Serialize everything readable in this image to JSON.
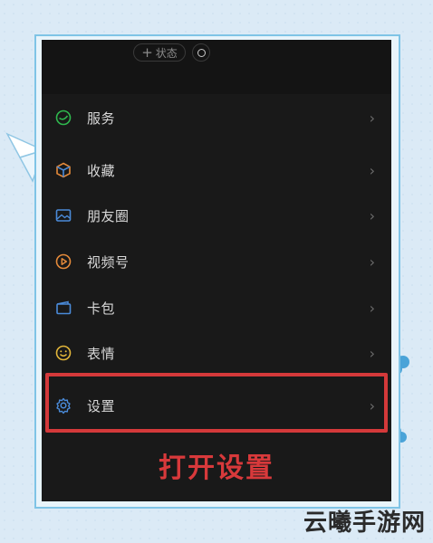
{
  "status_bar": {
    "plus_glyph": "+",
    "status_label": "状态"
  },
  "menu": {
    "items": [
      {
        "label": "服务",
        "icon": "service-icon",
        "color": "#2fb84e"
      },
      {
        "label": "收藏",
        "icon": "cube-icon",
        "color": "#e58a3a"
      },
      {
        "label": "朋友圈",
        "icon": "image-icon",
        "color": "#4a8ad8"
      },
      {
        "label": "视频号",
        "icon": "play-icon",
        "color": "#e58a3a"
      },
      {
        "label": "卡包",
        "icon": "wallet-icon",
        "color": "#4a8ad8"
      },
      {
        "label": "表情",
        "icon": "smile-icon",
        "color": "#e2b63a"
      },
      {
        "label": "设置",
        "icon": "gear-icon",
        "color": "#4a8ad8"
      }
    ],
    "chevron": "›"
  },
  "caption": "打开设置",
  "highlight_color": "#d4393a",
  "watermark": "云曦手游网"
}
